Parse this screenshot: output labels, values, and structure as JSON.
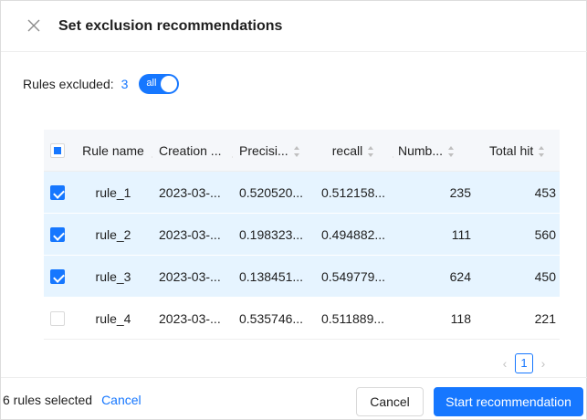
{
  "header": {
    "title": "Set exclusion recommendations"
  },
  "summary": {
    "label": "Rules excluded:",
    "count": "3",
    "toggle_label": "all",
    "toggle_on": true
  },
  "table": {
    "columns": [
      "Rule name",
      "Creation ...",
      "Precisi...",
      "recall",
      "Numb...",
      "Total hit"
    ],
    "rows": [
      {
        "checked": true,
        "name": "rule_1",
        "created": "2023-03-...",
        "precision": "0.520520...",
        "recall": "0.512158...",
        "number": "235",
        "total": "453"
      },
      {
        "checked": true,
        "name": "rule_2",
        "created": "2023-03-...",
        "precision": "0.198323...",
        "recall": "0.494882...",
        "number": "111",
        "total": "560"
      },
      {
        "checked": true,
        "name": "rule_3",
        "created": "2023-03-...",
        "precision": "0.138451...",
        "recall": "0.549779...",
        "number": "624",
        "total": "450"
      },
      {
        "checked": false,
        "name": "rule_4",
        "created": "2023-03-...",
        "precision": "0.535746...",
        "recall": "0.511889...",
        "number": "118",
        "total": "221"
      }
    ]
  },
  "pagination": {
    "prev": "‹",
    "current": "1",
    "next": "›"
  },
  "footer": {
    "selected_text": "6 rules selected",
    "clear_link": "Cancel",
    "cancel_label": "Cancel",
    "start_label": "Start recommendation"
  },
  "colors": {
    "accent": "#1677ff",
    "selected_row": "#e6f4ff",
    "header_bg": "#f5f7fa"
  }
}
